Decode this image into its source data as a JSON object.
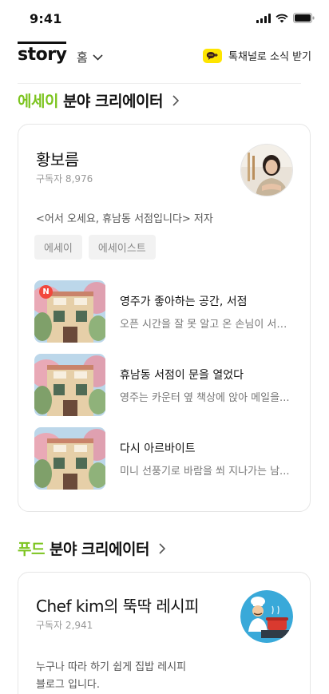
{
  "status": {
    "time": "9:41"
  },
  "header": {
    "logo": "story",
    "nav_label": "홈",
    "subscribe_label": "톡채널로 소식 받기"
  },
  "sections": [
    {
      "accent": "에세이",
      "title": "분야 크리에이터",
      "creator": {
        "name": "황보름",
        "subscribers": "구독자 8,976",
        "description": "<어서 오세요, 휴남동 서점입니다> 저자",
        "tags": [
          "에세이",
          "에세이스트"
        ],
        "posts": [
          {
            "title": "영주가 좋아하는 공간, 서점",
            "summary": "오픈 시간을 잘 못 알고 온 손님이 서점...",
            "badge": "N"
          },
          {
            "title": "휴남동 서점이 문을 열었다",
            "summary": "영주는 카운터 옆 책상에 앉아 메일을...",
            "badge": ""
          },
          {
            "title": "다시 아르바이트",
            "summary": "미니 선풍기로 바람을 쐬 지나가는 남...",
            "badge": ""
          }
        ]
      }
    },
    {
      "accent": "푸드",
      "title": "분야 크리에이터",
      "creator": {
        "name": "Chef kim의 뚝딱 레시피",
        "subscribers": "구독자 2,941",
        "description_lines": [
          "누구나 따라 하기 쉽게 집밥 레시피",
          "블로그 입니다."
        ]
      }
    }
  ],
  "colors": {
    "accent": "#7cc41f",
    "kakao": "#fee500",
    "new_badge": "#f2483d"
  },
  "icons": {
    "status": [
      "signal-icon",
      "wifi-icon",
      "battery-icon"
    ],
    "nav": "chevron-down-icon",
    "subscribe": "kakao-talk-icon",
    "section": "chevron-right-icon"
  }
}
